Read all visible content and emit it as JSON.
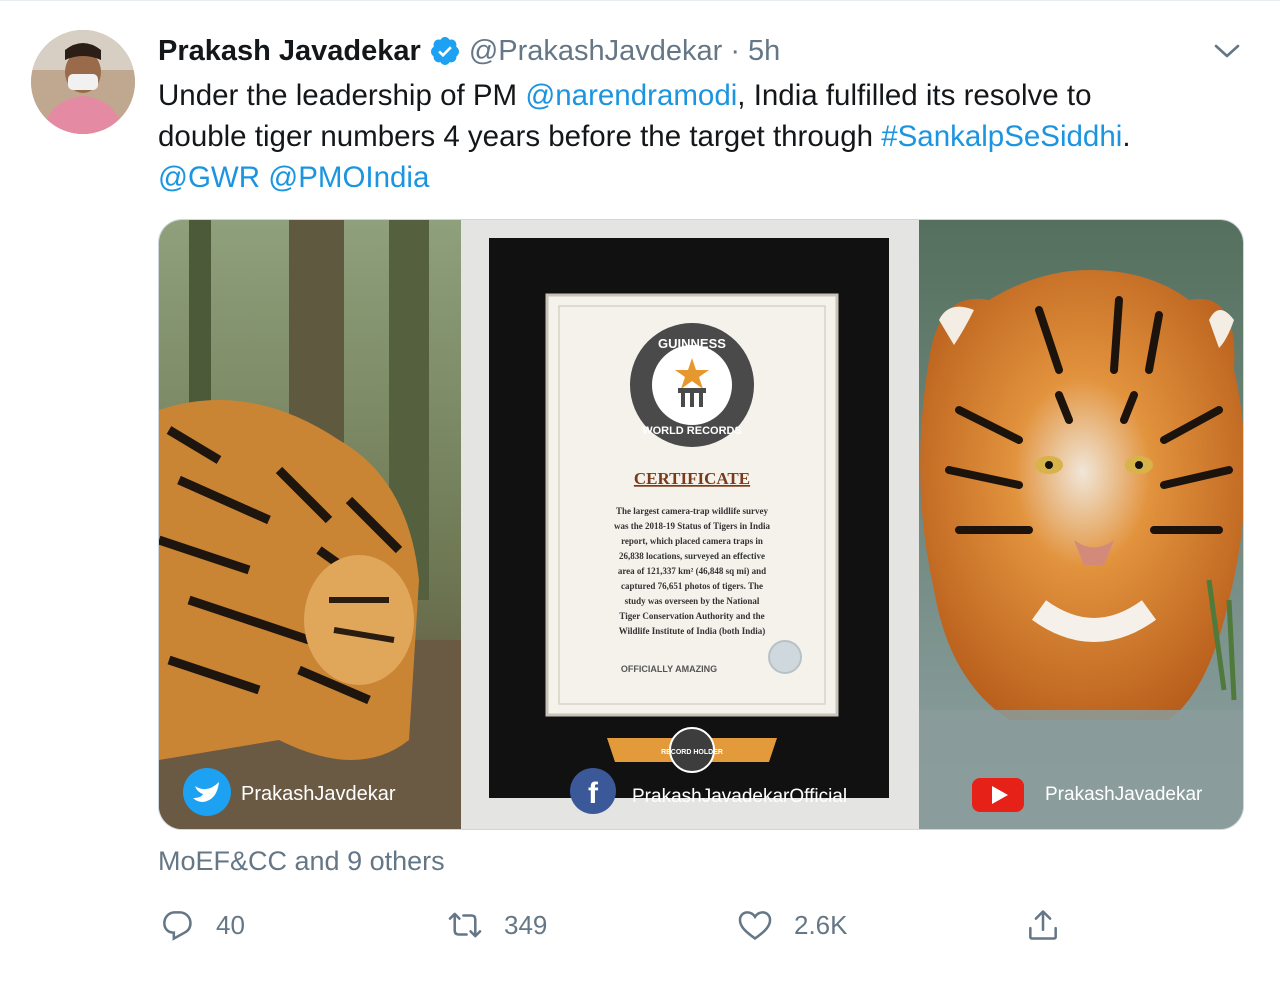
{
  "tweet": {
    "author_name": "Prakash Javadekar",
    "author_handle": "@PrakashJavdekar",
    "separator": "·",
    "time": "5h",
    "text_part1": "Under the leadership of PM ",
    "mention_pm": "@narendramodi",
    "text_part2": ", India fulfilled its resolve to",
    "text_part3": "double tiger numbers 4 years before the target through ",
    "hashtag": "#SankalpSeSiddhi",
    "text_part4": ".",
    "mention_gwr": "@GWR",
    "mention_pmo": "@PMOIndia"
  },
  "media": {
    "left_watermark": "PrakashJavdekar",
    "center_watermark": "PrakashJavadekarOfficial",
    "right_watermark": "PrakashJavadekar",
    "certificate": {
      "seal_top": "GUINNESS",
      "seal_bottom": "WORLD RECORDS",
      "title": "CERTIFICATE",
      "body_lines": [
        "The largest camera-trap wildlife survey",
        "was the 2018-19 Status of Tigers in India",
        "report, which placed camera traps in",
        "26,838 locations, surveyed an effective",
        "area of 121,337 km² (46,848 sq mi) and",
        "captured 76,651 photos of tigers. The",
        "study was overseen by the National",
        "Tiger Conservation Authority and the",
        "Wildlife Institute of India (both India)"
      ],
      "footer": "OFFICIALLY AMAZING",
      "banner": "RECORD HOLDER"
    }
  },
  "social_context": "MoEF&CC and 9 others",
  "actions": {
    "replies": "40",
    "retweets": "349",
    "likes": "2.6K"
  },
  "colors": {
    "link": "#1b95e0",
    "secondary_text": "#657786",
    "verified": "#1da1f2"
  },
  "icons": [
    "verified-badge-icon",
    "chevron-down-icon",
    "reply-icon",
    "retweet-icon",
    "like-icon",
    "share-icon",
    "twitter-logo-icon",
    "facebook-logo-icon",
    "youtube-logo-icon"
  ]
}
